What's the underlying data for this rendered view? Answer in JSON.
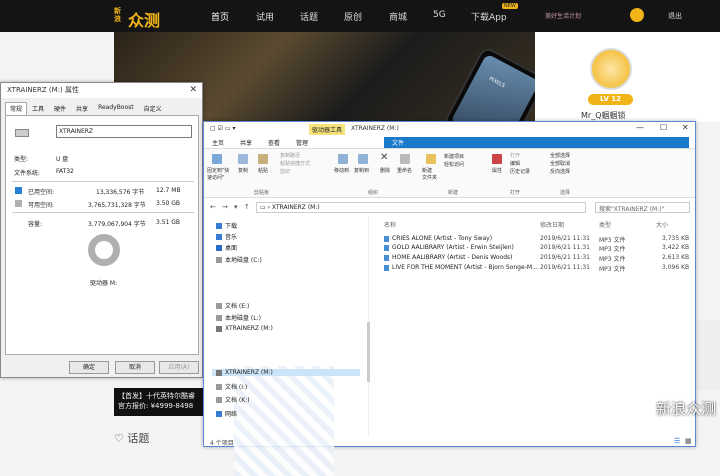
{
  "site": {
    "logo_small": "新浪",
    "logo": "众测",
    "nav": [
      "首页",
      "试用",
      "话题",
      "原创",
      "商城",
      "5G",
      "下载App"
    ],
    "hot_badge": "NEW",
    "brand_plan": "美好生活计划",
    "logout": "退出",
    "user": {
      "level": "LV 12",
      "name": "Mr_Q蝈蝈锁"
    },
    "ad_line1": "【首发】十代英特尔酷睿",
    "ad_line2": "官方报价: ¥4999-8498",
    "topic": "话题",
    "watermark": "新浪众测",
    "phone_text": "PIXELS"
  },
  "props": {
    "title": "XTRAINERZ (M:) 属性",
    "tabs": [
      "常规",
      "工具",
      "硬件",
      "共享",
      "ReadyBoost",
      "自定义"
    ],
    "name_value": "XTRAINERZ",
    "type_label": "类型:",
    "type_value": "U 盘",
    "fs_label": "文件系统:",
    "fs_value": "FAT32",
    "used_label": "已用空间:",
    "used_bytes": "13,336,576 字节",
    "used_size": "12.7 MB",
    "free_label": "可用空间:",
    "free_bytes": "3,765,731,328 字节",
    "free_size": "3.50 GB",
    "cap_label": "容量:",
    "cap_bytes": "3,779,067,904 字节",
    "cap_size": "3.51 GB",
    "drive_label": "驱动器 M:",
    "ok": "确定",
    "cancel": "取消",
    "apply": "应用(A)",
    "used_color": "#2680d6",
    "free_color": "#b0b0b0"
  },
  "explorer": {
    "tool_tab": "驱动器工具",
    "title": "XTRAINERZ (M:)",
    "ribbon_tabs": [
      "文件",
      "主页",
      "共享",
      "查看",
      "管理"
    ],
    "ribbon": {
      "pin": "固定到\"快速访问\"",
      "copy": "复制",
      "paste": "粘贴",
      "copy_path": "复制路径",
      "paste_shortcut": "粘贴快捷方式",
      "cut": "剪切",
      "move_to": "移动到",
      "copy_to": "复制到",
      "delete": "删除",
      "rename": "重命名",
      "new_folder": "新建\n文件夹",
      "new_item": "新建项目",
      "easy_access": "轻松访问",
      "properties": "属性",
      "open": "打开",
      "edit": "编辑",
      "history": "历史记录",
      "select_all": "全部选择",
      "select_none": "全部取消",
      "invert": "反向选择",
      "g_clipboard": "剪贴板",
      "g_organize": "组织",
      "g_new": "新建",
      "g_open": "打开",
      "g_select": "选择"
    },
    "address": "XTRAINERZ (M:)",
    "search_placeholder": "搜索\"XTRAINERZ (M:)\"",
    "nav": [
      "下载",
      "音乐",
      "桌面",
      "本地磁盘 (C:)",
      "文档 (E:)",
      "本地磁盘 (L:)",
      "XTRAINERZ (M:)",
      "XTRAINERZ (M:)",
      "文档 (I:)",
      "文档 (K:)",
      "网络"
    ],
    "columns": [
      "名称",
      "修改日期",
      "类型",
      "大小"
    ],
    "files": [
      {
        "name": "CRIES ALONE (Artist - Tony Sway)",
        "date": "2019/6/21 11:31",
        "type": "MP3 文件",
        "size": "3,735 KB"
      },
      {
        "name": "GOLD AALIBRARY (Artist - Erwin Steijlen)",
        "date": "2019/6/21 11:31",
        "type": "MP3 文件",
        "size": "3,422 KB"
      },
      {
        "name": "HOME AALIBRARY (Artist - Denis Woods)",
        "date": "2019/6/21 11:31",
        "type": "MP3 文件",
        "size": "2,613 KB"
      },
      {
        "name": "LIVE FOR THE MOMENT (Artist - Bjorn Songe-M...",
        "date": "2019/6/21 11:31",
        "type": "MP3 文件",
        "size": "3,096 KB"
      }
    ],
    "status": "4 个项目"
  }
}
